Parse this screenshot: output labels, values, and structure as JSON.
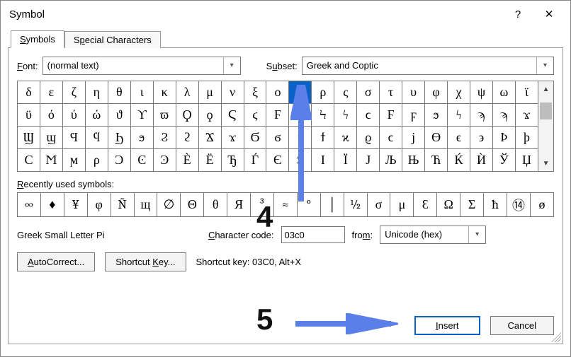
{
  "window": {
    "title": "Symbol",
    "help": "?",
    "close": "✕"
  },
  "tabs": {
    "active": "Symbols",
    "other": "Special Characters"
  },
  "font": {
    "label": "Font:",
    "value": "(normal text)"
  },
  "subset": {
    "label": "Subset:",
    "value": "Greek and Coptic"
  },
  "grid": {
    "selected": "π",
    "rows": [
      [
        "δ",
        "ε",
        "ζ",
        "η",
        "θ",
        "ι",
        "κ",
        "λ",
        "μ",
        "ν",
        "ξ",
        "ο",
        "π",
        "ρ",
        "ς",
        "σ",
        "τ",
        "υ",
        "φ",
        "χ",
        "ψ",
        "ω",
        "ϊ"
      ],
      [
        "ϋ",
        "ό",
        "ύ",
        "ώ",
        "ϑ",
        "ϒ",
        "ϖ",
        "Ϙ",
        "ϙ",
        "Ϛ",
        "ϛ",
        "Ϝ",
        "ϝ",
        "Ϟ",
        "ϟ",
        "ϲ",
        "Ϝ",
        "ϝ",
        "ϧ",
        "ϟ",
        "ϡ",
        "ϡ",
        "ϫ"
      ],
      [
        "Ϣ",
        "ϣ",
        "Ϥ",
        "ϥ",
        "Ϧ",
        "ϧ",
        "Ϩ",
        "ϩ",
        "Ϫ",
        "ϫ",
        "Ϭ",
        "ϭ",
        "ϯ",
        "ϯ",
        "ϰ",
        "ϱ",
        "ϲ",
        "ϳ",
        "ϴ",
        "ϵ",
        "϶",
        "Ϸ",
        "ϸ"
      ],
      [
        "Ϲ",
        "Ϻ",
        "ϻ",
        "ρ",
        "Ͻ",
        "Ͼ",
        "Ͽ",
        "Ѐ",
        "Ё",
        "Ђ",
        "Ѓ",
        "Є",
        "Ѕ",
        "І",
        "Ї",
        "Ј",
        "Љ",
        "Њ",
        "Ћ",
        "Ќ",
        "Ѝ",
        "Ў",
        "Џ"
      ]
    ]
  },
  "recent_label": "Recently used symbols:",
  "recent": [
    "∞",
    "♦",
    "¥",
    "φ",
    "Ñ",
    "щ",
    "∅",
    "Θ",
    "θ",
    "Я",
    "³",
    "≈",
    "°",
    "│",
    "½",
    "σ",
    "μ",
    "Ɛ",
    "Ω",
    "Σ",
    "ħ",
    "⑭",
    "ø"
  ],
  "char_name": "Greek Small Letter Pi",
  "char_code": {
    "label": "Character code:",
    "value": "03c0"
  },
  "from": {
    "label": "from:",
    "value": "Unicode (hex)"
  },
  "buttons": {
    "autocorrect": "AutoCorrect...",
    "shortcut": "Shortcut Key...",
    "shortcut_info_label": "Shortcut key:",
    "shortcut_info_value": "03C0, Alt+X",
    "insert": "Insert",
    "cancel": "Cancel"
  },
  "annotations": {
    "n4": "4",
    "n5": "5"
  }
}
